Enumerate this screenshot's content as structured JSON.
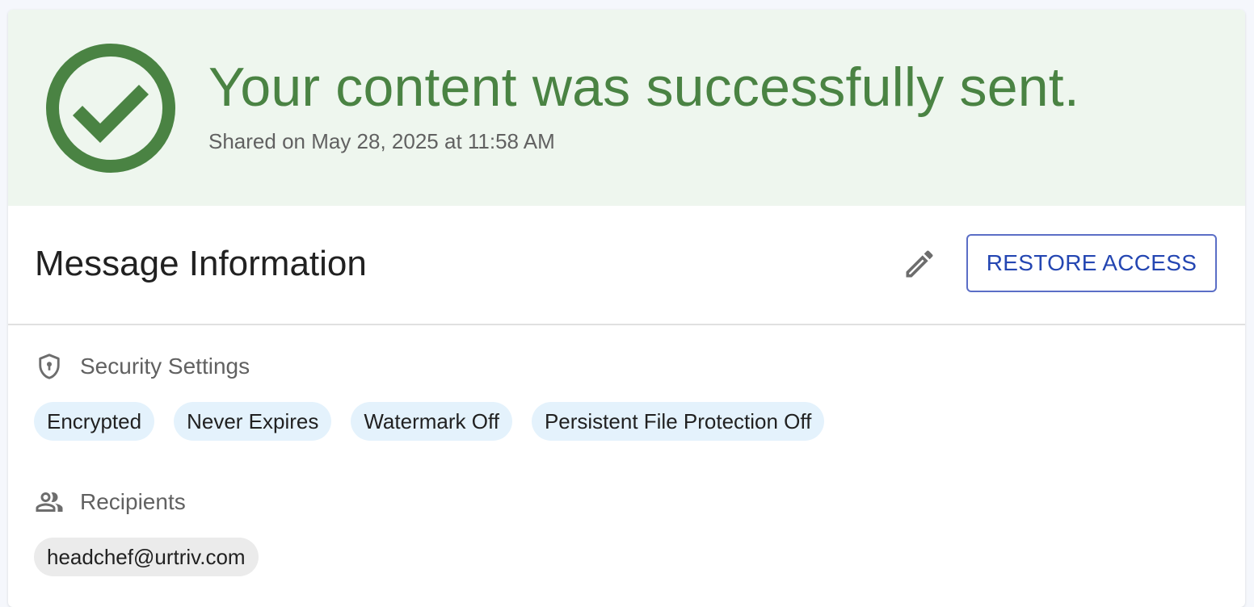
{
  "banner": {
    "title": "Your content was successfully sent.",
    "subtitle": "Shared on May 28, 2025 at 11:58 AM",
    "icon": "check-circle-icon",
    "accent_color": "#4a8343",
    "background_color": "#eef6ee"
  },
  "message_info": {
    "title": "Message Information",
    "edit_icon": "pencil-icon",
    "restore_button_label": "RESTORE ACCESS",
    "button_color": "#2446b2"
  },
  "security": {
    "label": "Security Settings",
    "icon": "shield-icon",
    "chips": [
      "Encrypted",
      "Never Expires",
      "Watermark Off",
      "Persistent File Protection Off"
    ],
    "chip_color": "#e4f2fc"
  },
  "recipients": {
    "label": "Recipients",
    "icon": "people-icon",
    "items": [
      "headchef@urtriv.com"
    ],
    "chip_color": "#ebebeb"
  }
}
